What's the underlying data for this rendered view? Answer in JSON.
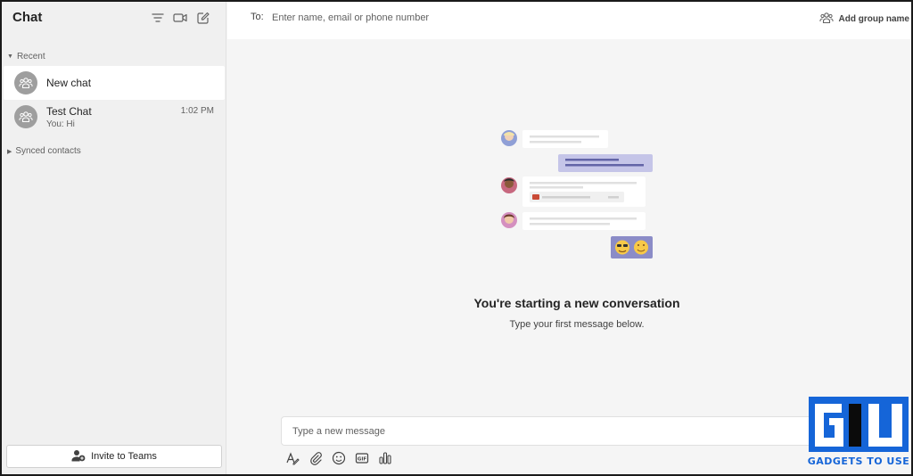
{
  "sidebar": {
    "title": "Chat",
    "sections": {
      "recent_label": "Recent",
      "synced_label": "Synced contacts"
    },
    "chats": [
      {
        "name": "New chat",
        "subtitle": "",
        "time": "",
        "active": true
      },
      {
        "name": "Test Chat",
        "subtitle": "You: Hi",
        "time": "1:02 PM",
        "active": false
      }
    ],
    "invite_label": "Invite to Teams"
  },
  "header": {
    "to_label": "To:",
    "to_placeholder": "Enter name, email or phone number",
    "add_group_label": "Add group name"
  },
  "main": {
    "headline": "You're starting a new conversation",
    "subline": "Type your first message below."
  },
  "composer": {
    "placeholder": "Type a new message",
    "tools": [
      "format-icon",
      "attach-icon",
      "emoji-icon",
      "gif-icon",
      "poll-icon"
    ]
  },
  "watermark": {
    "text": "GADGETS TO USE"
  },
  "colors": {
    "accent": "#6264a7",
    "accent_light": "#c5c5e8",
    "watermark_blue": "#1565d8"
  }
}
